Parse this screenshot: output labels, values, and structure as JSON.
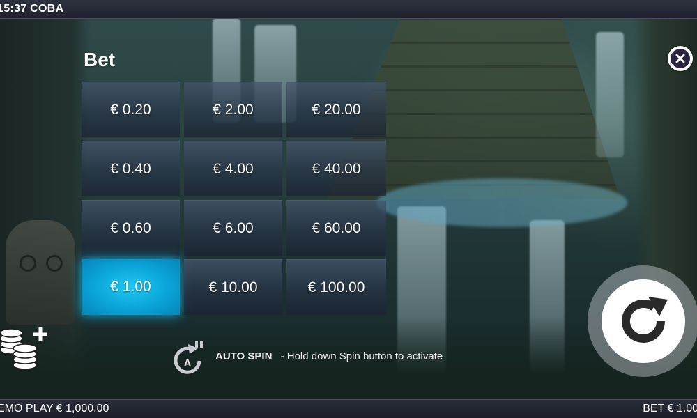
{
  "topbar": {
    "time": "15:37",
    "game_name": "COBA"
  },
  "bet_panel": {
    "title": "Bet",
    "options": [
      {
        "label": "€ 0.20",
        "selected": false
      },
      {
        "label": "€ 2.00",
        "selected": false
      },
      {
        "label": "€ 20.00",
        "selected": false
      },
      {
        "label": "€ 0.40",
        "selected": false
      },
      {
        "label": "€ 4.00",
        "selected": false
      },
      {
        "label": "€ 40.00",
        "selected": false
      },
      {
        "label": "€ 0.60",
        "selected": false
      },
      {
        "label": "€ 6.00",
        "selected": false
      },
      {
        "label": "€ 60.00",
        "selected": false
      },
      {
        "label": "€ 1.00",
        "selected": true
      },
      {
        "label": "€ 10.00",
        "selected": false
      },
      {
        "label": "€ 100.00",
        "selected": false
      }
    ]
  },
  "auto_spin": {
    "label": "AUTO SPIN",
    "hint": "- Hold down Spin button to activate",
    "icon_letter": "A"
  },
  "bottombar": {
    "left_text": "EMO PLAY € 1,000.00",
    "right_text": "BET € 1.00"
  },
  "icons": {
    "close": "close-icon",
    "spin": "spin-icon",
    "coins": "coins-add-icon",
    "autospin": "autospin-icon"
  },
  "colors": {
    "selected_bet": "#1ec8f0",
    "close_inner": "#2a2440"
  }
}
